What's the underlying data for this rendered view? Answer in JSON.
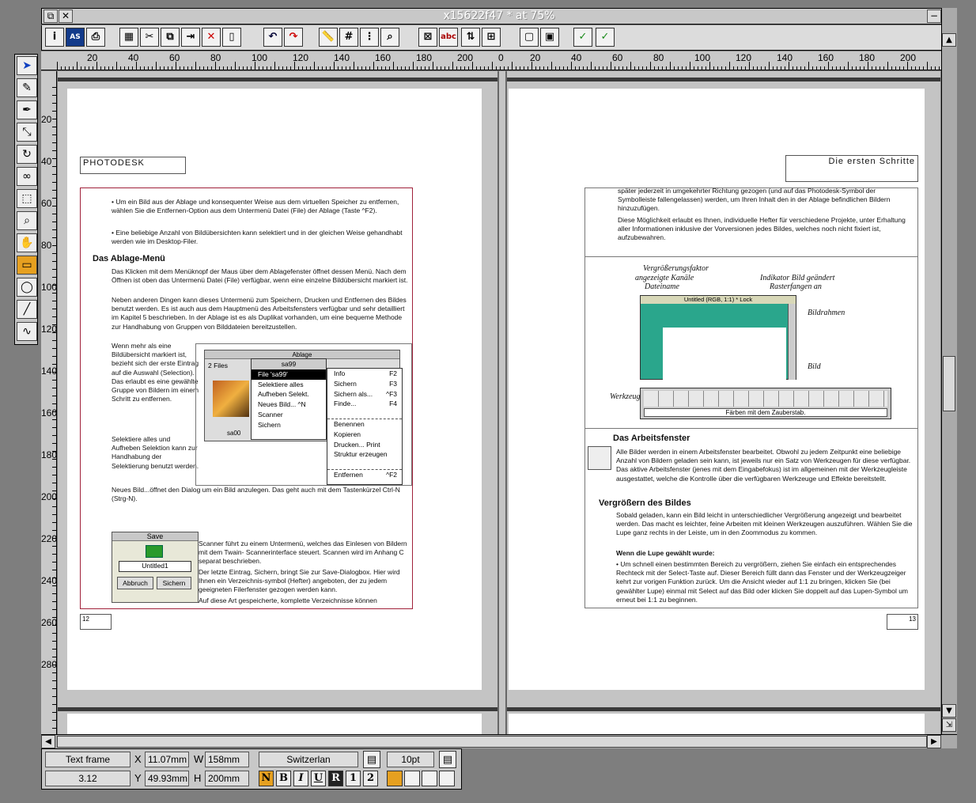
{
  "window": {
    "title": "x15622f47 * at 75%"
  },
  "toolbar": {
    "icons": [
      "info-icon",
      "save-icon",
      "print-icon",
      "grid-select-icon",
      "cut-icon",
      "copy-icon",
      "paste-icon",
      "delete-icon",
      "clipboard-icon",
      "undo-icon",
      "redo-icon",
      "ruler-icon",
      "grid-icon",
      "snap-grid-icon",
      "zoom-icon",
      "frame-icon",
      "abc-text-icon",
      "text-flow-icon",
      "link-icon",
      "frame-outline-icon",
      "frame-red-icon",
      "spellcheck-icon",
      "abc-spellcheck-icon"
    ],
    "labels": {
      "abc": "abc",
      "abc2": "abc"
    }
  },
  "ruler": {
    "left_numbers": [
      "20",
      "40",
      "60",
      "80",
      "100",
      "120",
      "140",
      "160",
      "180",
      "200",
      "0"
    ],
    "right_numbers": [
      "20",
      "40",
      "60",
      "80",
      "100",
      "120",
      "140",
      "160",
      "180",
      "200"
    ],
    "vertical_numbers": [
      "20",
      "40",
      "60",
      "80",
      "100",
      "120",
      "140",
      "160",
      "180",
      "200",
      "220",
      "240",
      "260",
      "280"
    ]
  },
  "left_page": {
    "header": "PHOTODESK",
    "bullet1": "Um ein Bild aus der Ablage und konsequenter Weise aus dem virtuellen Speicher zu entfernen, wählen Sie die Entfernen-Option aus dem Untermenü Datei (File) der Ablage (Taste ^F2).",
    "bullet2": "Eine beliebige Anzahl von Bildübersichten kann selektiert und in der gleichen Weise gehandhabt werden wie im Desktop-Filer.",
    "section_title": "Das Ablage-Menü",
    "p1": "Das Klicken mit dem Menüknopf der Maus über dem Ablagefenster öffnet dessen Menü. Nach dem Öffnen ist oben das Untermenü Datei (File) verfügbar, wenn eine einzelne Bildübersicht markiert ist.",
    "p2": "Neben anderen Dingen kann dieses Untermenü zum Speichern, Drucken und Entfernen des Bildes benutzt werden. Es ist auch aus dem Hauptmenü des Arbeitsfensters verfügbar und sehr detailliert im Kapitel 5 beschrieben. In der Ablage ist es als Duplikat vorhanden, um eine bequeme Methode zur Handhabung von Gruppen von Bilddateien bereitzustellen.",
    "p3": "Wenn mehr als eine Bildübersicht markiert ist, bezieht sich der erste Eintrag auf die Auswahl (Selection). Das erlaubt es eine gewählte Gruppe von Bildern im einem Schritt zu entfernen.",
    "p4": "Selektiere alles und Aufheben Selektion kann zur Handhabung der Selektierung benutzt werden.",
    "p5": "Neues Bild...öffnet den Dialog um ein Bild anzulegen. Das geht auch mit dem Tastenkürzel Ctrl-N (Strg-N).",
    "p6": "Scanner führt zu einem Untermenü, welches das Einlesen von Bildern mit dem Twain- Scannerinterface steuert. Scannen wird im Anhang C separat beschrieben.",
    "p7": "Der letzte Eintrag, Sichern, bringt Sie zur Save-Dialogbox. Hier wird Ihnen ein Verzeichnis-symbol (Hefter) angeboten, der zu jedem geeigneten Filerfenster gezogen werden kann.",
    "p8": "Auf diese Art gespeicherte, komplette Verzeichnisse können",
    "page_number": "12",
    "ablage_window": {
      "title": "Ablage",
      "files_label": "2 Files",
      "thumb1": "sa00",
      "thumb2": "sa99",
      "menu_title": "sa99",
      "menu_left": [
        "File 'sa99'",
        "Selektiere alles",
        "Aufheben Selekt.",
        "Neues Bild...  ^N",
        "Scanner",
        "Sichern"
      ],
      "menu_right": [
        "Info",
        "Sichern",
        "Sichern als...",
        "Finde...",
        "",
        "Benennen",
        "Kopieren",
        "Drucken...   Print",
        "Struktur erzeugen",
        "",
        "Entfernen"
      ],
      "menu_right_keys": [
        "F2",
        "F3",
        "^F3",
        "F4",
        "",
        "",
        "",
        "",
        "",
        "",
        "^F2"
      ]
    },
    "save_dialog": {
      "title": "Save",
      "filename": "Untitled1",
      "cancel": "Abbruch",
      "save": "Sichern"
    }
  },
  "right_page": {
    "header": "Die ersten Schritte",
    "p1": "später jederzeit in umgekehrter Richtung gezogen (und auf das Photodesk-Symbol der Symbolleiste fallengelassen) werden, um Ihren Inhalt den in der Ablage befindlichen Bildern hinzuzufügen.",
    "p2": "Diese Möglichkeit erlaubt es Ihnen, individuelle Hefter für verschiedene Projekte, unter Erhaltung aller Informationen inklusive der Vorversionen jedes Bildes, welches noch nicht fixiert ist, aufzubewahren.",
    "diagram": {
      "label_zoom": "Vergrößerungsfaktor",
      "label_channels": "angezeigte Kanäle",
      "label_filename": "Dateiname",
      "label_changed": "Indikator Bild geändert",
      "label_snap": "Rasterfangen an",
      "label_frame": "Bildrahmen",
      "label_image": "Bild",
      "label_tools": "Werkzeugleiste",
      "window_title": "Untitled (RGB, 1:1) * Lock",
      "status": "Färben mit dem Zauberstab."
    },
    "section_title": "Das Arbeitsfenster",
    "p3": "Alle Bilder werden in einem Arbeitsfenster bearbeitet. Obwohl zu jedem Zeitpunkt eine beliebige Anzahl von Bildern geladen sein kann, ist jeweils nur ein Satz von Werkzeugen für diese verfügbar. Das aktive Arbeitsfenster (jenes mit dem Eingabefokus) ist im allgemeinen mit der Werkzeugleiste ausgestattet, welche die Kontrolle über die verfügbaren Werkzeuge und Effekte bereitstellt.",
    "subsection_title": "Vergrößern des Bildes",
    "p4": "Sobald geladen, kann ein Bild leicht in unterschiedlicher Vergrößerung angezeigt und bearbeitet werden. Das macht es leichter, feine Arbeiten mit kleinen Werkzeugen auszuführen. Wählen Sie die Lupe ganz rechts in der Leiste, um in den Zoommodus zu kommen.",
    "p5": "Wenn die Lupe gewählt wurde:",
    "p6": "Um schnell einen bestimmten Bereich zu vergrößern, ziehen Sie einfach ein entsprechendes Rechteck mit der Select-Taste auf. Dieser Bereich füllt dann das Fenster und der Werkzeugzeiger kehrt zur vorigen Funktion zurück. Um die Ansicht wieder auf 1:1 zu bringen, klicken Sie (bei gewählter Lupe) einmal mit Select auf das Bild oder klicken Sie doppelt auf das Lupen-Symbol um erneut bei 1:1 zu beginnen.",
    "page_number": "13"
  },
  "palette": {
    "tools": [
      "pointer-icon",
      "pencil-icon",
      "pen-icon",
      "node-edit-icon",
      "rotate-icon",
      "link-frames-icon",
      "select-rect-icon",
      "magnifier-icon",
      "hand-icon",
      "rectangle-icon",
      "ellipse-icon",
      "line-icon",
      "curve-icon"
    ],
    "active": "rectangle-icon"
  },
  "infobar": {
    "type": "Text frame",
    "value": "3.12",
    "x_label": "X",
    "x": "11.07mm",
    "y_label": "Y",
    "y": "49.93mm",
    "w_label": "W",
    "w": "158mm",
    "h_label": "H",
    "h": "200mm",
    "font": "Switzerlan",
    "size": "10pt",
    "style_buttons": [
      "N",
      "B",
      "I",
      "U",
      "R",
      "1",
      "2"
    ]
  }
}
